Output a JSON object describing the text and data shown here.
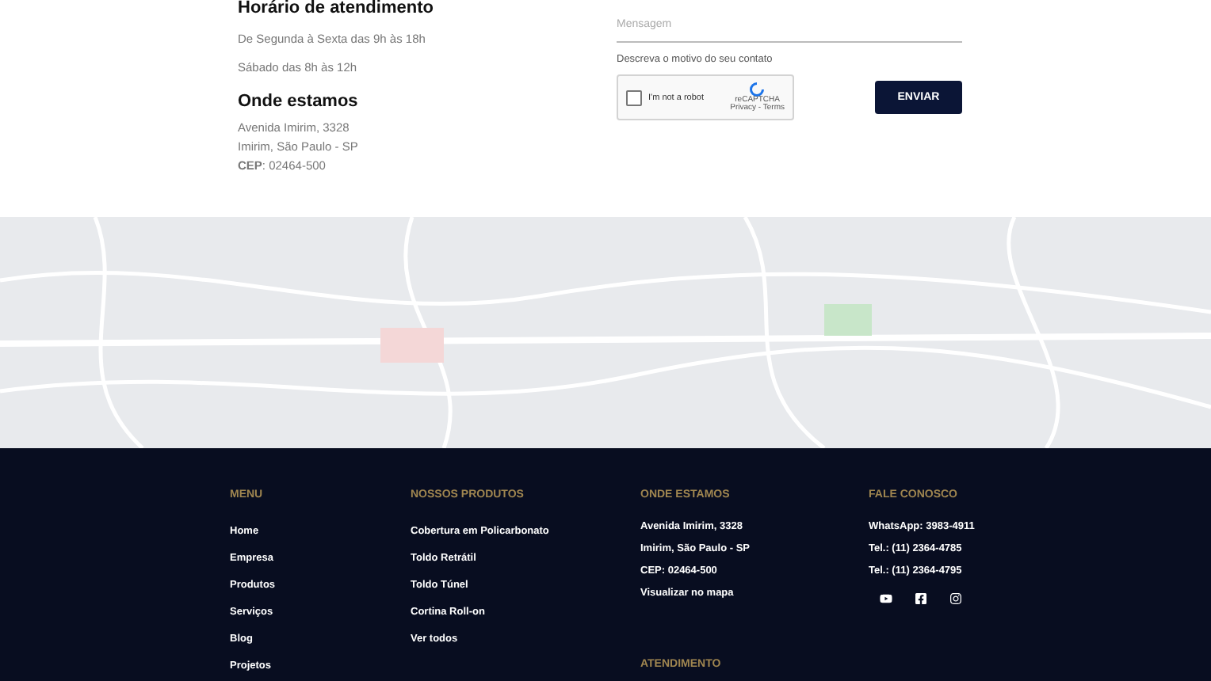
{
  "hours": {
    "title": "Horário de atendimento",
    "lines": [
      "De Segunda à Sexta das 9h às 18h",
      "Sábado das 8h às 12h"
    ]
  },
  "location": {
    "title": "Onde estamos",
    "lines": [
      "Avenida Imirim, 3328",
      "Imirim, São Paulo - SP",
      "**CEP**: 02464-500"
    ]
  },
  "form": {
    "message": {
      "placeholder": "Mensagem"
    },
    "hint": "Descreva o motivo do seu contato",
    "captcha": {
      "label": "I'm not a robot",
      "checked": false,
      "brand": "reCAPTCHA",
      "links": "Privacy - Terms"
    },
    "submit": "ENVIAR"
  },
  "footer": {
    "columns": [
      {
        "title": "MENU",
        "links": [
          "Home",
          "Empresa",
          "Produtos",
          "Serviços",
          "Blog",
          "Projetos"
        ]
      },
      {
        "title": "NOSSOS PRODUTOS",
        "links": [
          "Cobertura em Policarbonato",
          "Toldo Retrátil",
          "Toldo Túnel",
          "Cortina Roll-on",
          "Ver todos"
        ]
      },
      {
        "title": "ONDE ESTAMOS",
        "links": [
          "Avenida Imirim, 3328",
          "Imirim, São Paulo - SP",
          "CEP: 02464-500",
          "Visualizar no mapa"
        ],
        "subtitle": "ATENDIMENTO"
      },
      {
        "title": "FALE CONOSCO",
        "links": [
          "WhatsApp: 3983-4911",
          "Tel.: (11) 2364-4785",
          "Tel.: (11) 2364-4795"
        ],
        "social": [
          {
            "kind": "youtube"
          },
          {
            "kind": "facebook"
          },
          {
            "kind": "instagram"
          }
        ]
      }
    ]
  }
}
